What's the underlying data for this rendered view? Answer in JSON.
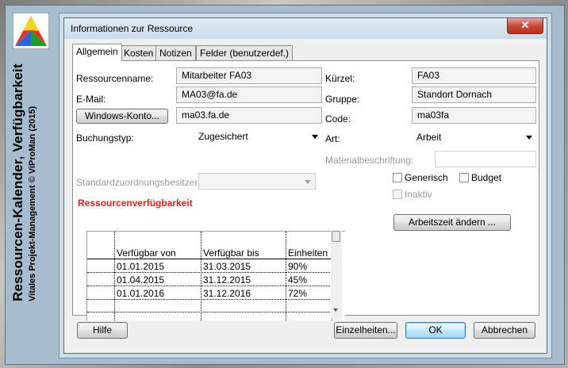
{
  "side": {
    "title": "Ressourcen-Kalender, Verfügbarkeit",
    "subtitle": "Vitales Projekt-Management © ViProMan (2015)"
  },
  "dialog": {
    "title": "Informationen zur Ressource",
    "close_label": "✕"
  },
  "tabs": [
    "Allgemein",
    "Kosten",
    "Notizen",
    "Felder (benutzerdef.)"
  ],
  "general": {
    "resource_name_label": "Ressourcenname:",
    "resource_name": "Mitarbeiter FA03",
    "email_label": "E-Mail:",
    "email": "MA03@fa.de",
    "windows_account_button": "Windows-Konto...",
    "windows_account": "ma03.fa.de",
    "booking_type_label": "Buchungstyp:",
    "booking_type": "Zugesichert",
    "assignment_owner_label": "Standardzuordnungsbesitzer:",
    "assignment_owner": "",
    "short_label": "Kürzel:",
    "short": "FA03",
    "group_label": "Gruppe:",
    "group": "Standort Dornach",
    "code_label": "Code:",
    "code": "ma03fa",
    "type_label": "Art:",
    "type": "Arbeit",
    "material_label": "Materialbeschriftung:",
    "material": "",
    "generic_label": "Generisch",
    "budget_label": "Budget",
    "inactive_label": "Inaktiv",
    "change_worktime_button": "Arbeitszeit ändern ..."
  },
  "availability": {
    "title": "Ressourcenverfügbarkeit",
    "headers": [
      "Verfügbar von",
      "Verfügbar bis",
      "Einheiten"
    ],
    "rows": [
      {
        "from": "01.01.2015",
        "to": "31.03.2015",
        "units": "90%"
      },
      {
        "from": "01.04.2015",
        "to": "31.12.2015",
        "units": "45%"
      },
      {
        "from": "01.01.2016",
        "to": "31.12.2016",
        "units": "72%"
      }
    ]
  },
  "footer": {
    "help": "Hilfe",
    "details": "Einzelheiten...",
    "ok": "OK",
    "cancel": "Abbrechen"
  },
  "colors": {
    "accent_red": "#e01e1e",
    "background": "#a7bccf"
  }
}
